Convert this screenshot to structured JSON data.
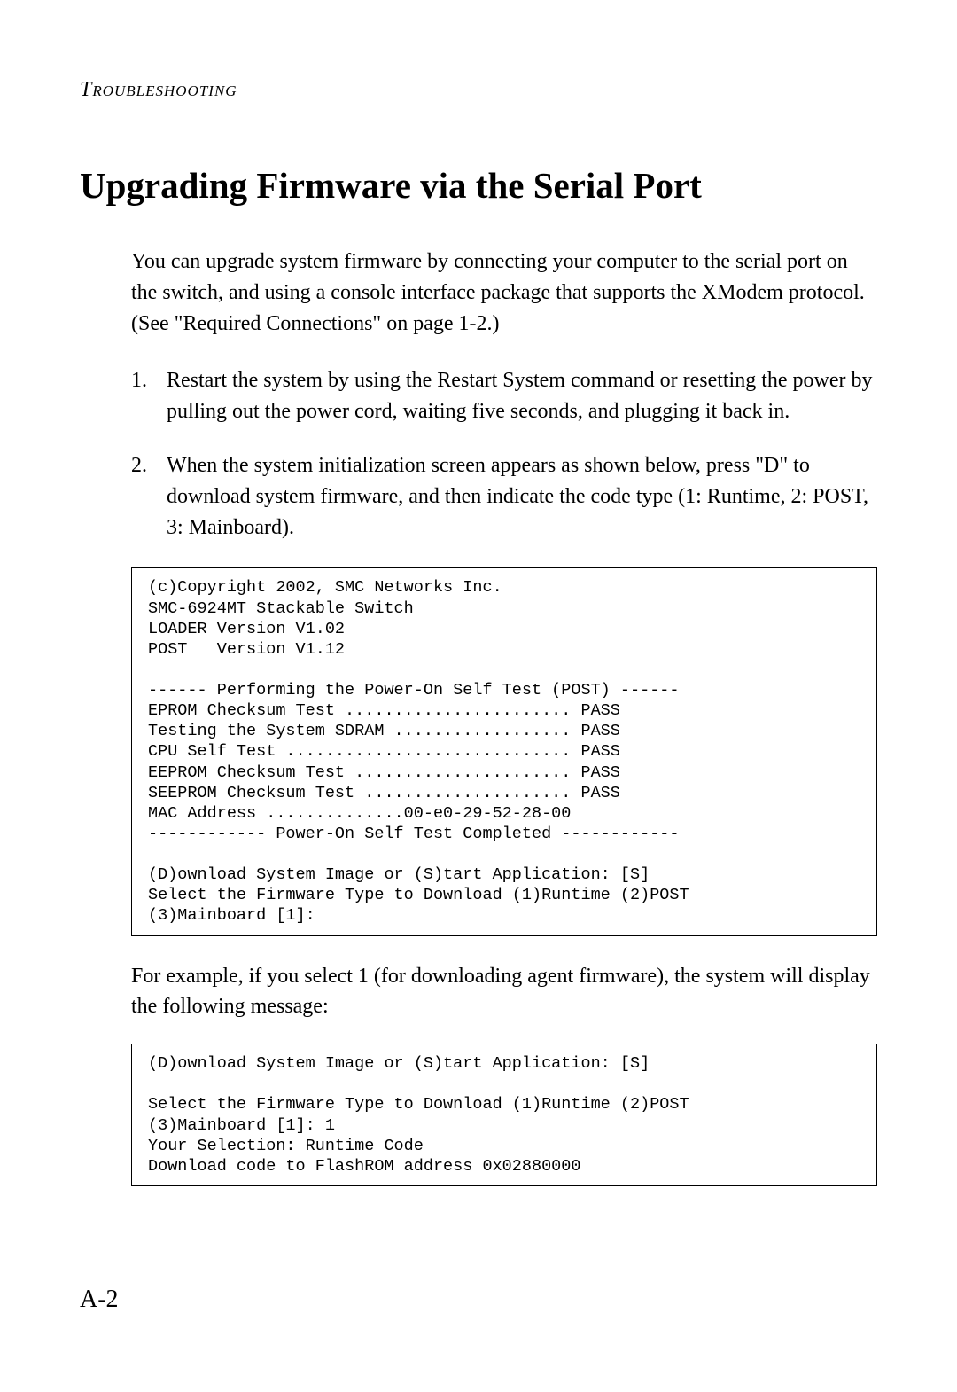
{
  "header": {
    "section_label": "Troubleshooting"
  },
  "page": {
    "title": "Upgrading Firmware via the Serial Port",
    "intro": "You can upgrade system firmware by connecting your computer to the serial port on the switch, and using a console interface package that supports the XModem protocol. (See \"Required Connections\" on page 1-2.)",
    "steps": [
      {
        "num": "1.",
        "text": "Restart the system by using the Restart System command or resetting the power by pulling out the power cord, waiting five seconds, and plugging it back in."
      },
      {
        "num": "2.",
        "text": "When the system initialization screen appears as shown below, press \"D\" to download system firmware, and then indicate the code type (1: Runtime, 2: POST, 3: Mainboard)."
      }
    ],
    "code_block_1": "(c)Copyright 2002, SMC Networks Inc.\nSMC-6924MT Stackable Switch\nLOADER Version V1.02\nPOST   Version V1.12\n\n------ Performing the Power-On Self Test (POST) ------\nEPROM Checksum Test ....................... PASS\nTesting the System SDRAM .................. PASS\nCPU Self Test ............................. PASS\nEEPROM Checksum Test ...................... PASS\nSEEPROM Checksum Test ..................... PASS\nMAC Address ..............00-e0-29-52-28-00\n------------ Power-On Self Test Completed ------------\n\n(D)ownload System Image or (S)tart Application: [S]\nSelect the Firmware Type to Download (1)Runtime (2)POST \n(3)Mainboard [1]:",
    "followup": "For example, if you select 1 (for downloading agent firmware), the system will display the following message:",
    "code_block_2": "(D)ownload System Image or (S)tart Application: [S]\n\nSelect the Firmware Type to Download (1)Runtime (2)POST \n(3)Mainboard [1]: 1\nYour Selection: Runtime Code\nDownload code to FlashROM address 0x02880000",
    "page_number": "A-2"
  }
}
